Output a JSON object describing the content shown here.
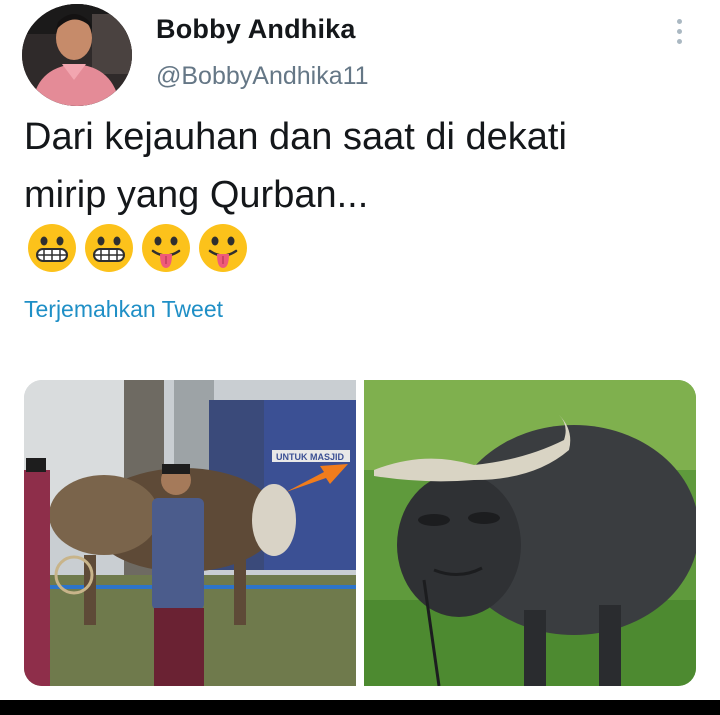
{
  "user": {
    "display_name": "Bobby Andhika",
    "handle": "@BobbyAndhika11",
    "avatar_icon": "profile-photo"
  },
  "tweet": {
    "text_line1": "Dari kejauhan dan saat di dekati",
    "text_line2": "mirip yang Qurban...",
    "emojis": [
      "grimacing-face",
      "grimacing-face",
      "face-with-tongue",
      "face-with-tongue"
    ],
    "translate_label": "Terjemahkan Tweet",
    "more_icon": "more-vertical-icon"
  },
  "media": {
    "left_photo_sign": "UNTUK MASJID",
    "arrow_color": "#f07c1c"
  },
  "colors": {
    "link": "#1f8fc6",
    "handle": "#657786",
    "text": "#14171a"
  }
}
